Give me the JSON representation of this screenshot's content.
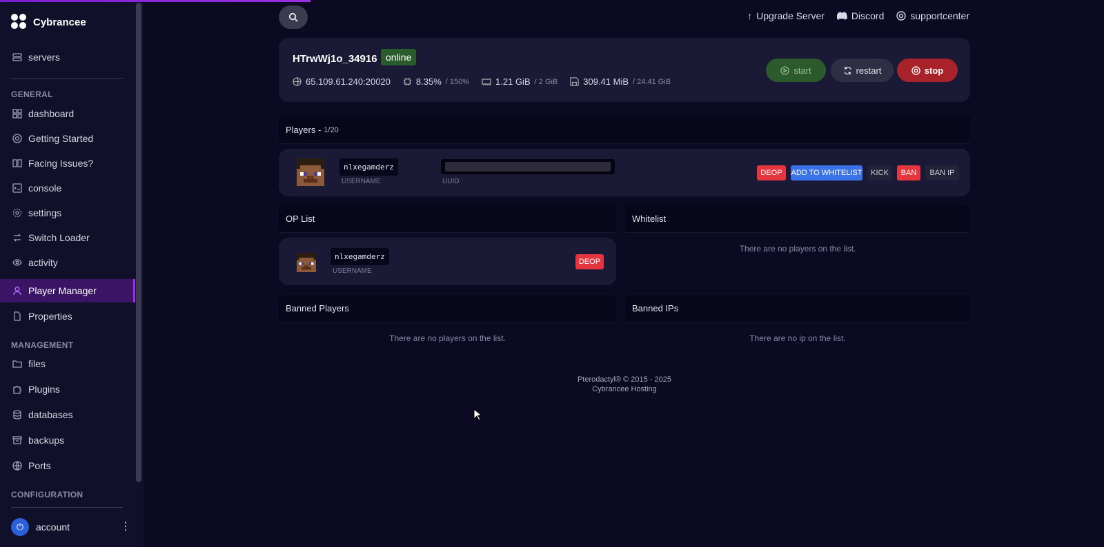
{
  "sidebar": {
    "brand": "Cybrancee",
    "servers_label": "servers",
    "sections": {
      "general": "GENERAL",
      "management": "MANAGEMENT",
      "configuration": "CONFIGURATION"
    },
    "items": [
      {
        "label": "dashboard",
        "icon": "grid-icon"
      },
      {
        "label": "Getting Started",
        "icon": "lifebuoy-icon"
      },
      {
        "label": "Facing Issues?",
        "icon": "book-icon"
      },
      {
        "label": "console",
        "icon": "terminal-icon"
      },
      {
        "label": "settings",
        "icon": "gear-icon"
      },
      {
        "label": "Switch Loader",
        "icon": "switch-icon"
      },
      {
        "label": "activity",
        "icon": "eye-icon"
      },
      {
        "label": "Player Manager",
        "icon": "user-icon",
        "active": true
      },
      {
        "label": "Properties",
        "icon": "file-icon"
      },
      {
        "label": "files",
        "icon": "folder-icon"
      },
      {
        "label": "Plugins",
        "icon": "puzzle-icon"
      },
      {
        "label": "databases",
        "icon": "database-icon"
      },
      {
        "label": "backups",
        "icon": "archive-icon"
      },
      {
        "label": "Ports",
        "icon": "globe-icon"
      }
    ],
    "account_label": "account"
  },
  "topbar": {
    "upgrade": "Upgrade Server",
    "discord": "Discord",
    "support": "supportcenter"
  },
  "server": {
    "name": "HTrwWj1o_34916",
    "status": "online",
    "address": "65.109.61.240:20020",
    "cpu": "8.35%",
    "cpu_limit": "/ 150%",
    "memory": "1.21 GiB",
    "memory_limit": "/ 2 GiB",
    "disk": "309.41 MiB",
    "disk_limit": "/ 24.41 GiB",
    "start_label": "start",
    "restart_label": "restart",
    "stop_label": "stop"
  },
  "players": {
    "title": "Players -",
    "count": "1/20",
    "username": "nlxegamderz",
    "username_caption": "USERNAME",
    "uuid_caption": "UUID",
    "actions": {
      "deop": "DEOP",
      "whitelist": "ADD TO WHITELIST",
      "kick": "KICK",
      "ban": "BAN",
      "ban_ip": "BAN IP"
    }
  },
  "op_list": {
    "title": "OP List",
    "username": "nlxegamderz",
    "username_caption": "USERNAME",
    "deop": "DEOP"
  },
  "whitelist": {
    "title": "Whitelist",
    "empty": "There are no players on the list."
  },
  "banned_players": {
    "title": "Banned Players",
    "empty": "There are no players on the list."
  },
  "banned_ips": {
    "title": "Banned IPs",
    "empty": "There are no ip on the list."
  },
  "footer": {
    "line1": "Pterodactyl® © 2015 - 2025",
    "line2": "Cybrancee Hosting"
  },
  "colors": {
    "background": "#0b0a22",
    "accent": "#9b2fe3",
    "online": "#2a5b2d",
    "danger": "#e5363f",
    "primary": "#3a73e8"
  }
}
